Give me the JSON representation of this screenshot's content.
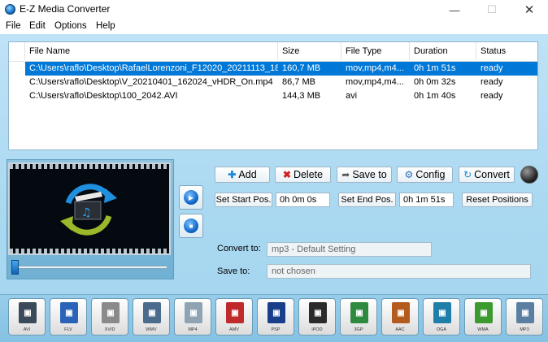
{
  "window": {
    "title": "E-Z Media Converter",
    "minimize": "—",
    "maximize": "☐",
    "close": "✕"
  },
  "menu": [
    "File",
    "Edit",
    "Options",
    "Help"
  ],
  "table": {
    "columns": [
      "File Name",
      "Size",
      "File Type",
      "Duration",
      "Status"
    ],
    "rows": [
      [
        "C:\\Users\\raflo\\Desktop\\RafaelLorenzoni_F12020_20211113_18...",
        "160,7 MB",
        "mov,mp4,m4...",
        "0h 1m 51s",
        "ready"
      ],
      [
        "C:\\Users\\raflo\\Desktop\\V_20210401_162024_vHDR_On.mp4",
        "86,7 MB",
        "mov,mp4,m4...",
        "0h 0m 32s",
        "ready"
      ],
      [
        "C:\\Users\\raflo\\Desktop\\100_2042.AVI",
        "144,3 MB",
        "avi",
        "0h 1m 40s",
        "ready"
      ]
    ],
    "selected_row": 0
  },
  "toolbar": {
    "add": "Add",
    "delete": "Delete",
    "save_to": "Save to",
    "config": "Config",
    "convert": "Convert"
  },
  "positions": {
    "set_start": "Set Start Pos.",
    "start_value": "0h 0m 0s",
    "set_end": "Set End Pos.",
    "end_value": "0h 1m 51s",
    "reset": "Reset Positions"
  },
  "output": {
    "convert_to_label": "Convert to:",
    "convert_to_value": "mp3 - Default Setting",
    "save_to_label": "Save to:",
    "save_to_value": "not chosen"
  },
  "formats": [
    {
      "name": "AVI",
      "color": "#3a4a5a"
    },
    {
      "name": "FLV",
      "color": "#2a63b8"
    },
    {
      "name": "XVID",
      "color": "#8a8a8a"
    },
    {
      "name": "WMV",
      "color": "#4a6b8c"
    },
    {
      "name": "MP4",
      "color": "#8fa3b3"
    },
    {
      "name": "AMV",
      "color": "#c02a2a"
    },
    {
      "name": "PSP",
      "color": "#1a3f8a"
    },
    {
      "name": "iPOD",
      "color": "#2b2b2b"
    },
    {
      "name": "3GP",
      "color": "#2e8a3e"
    },
    {
      "name": "AAC",
      "color": "#b35a1e"
    },
    {
      "name": "OGA",
      "color": "#1f7fa8"
    },
    {
      "name": "WMA",
      "color": "#3d9a2f"
    },
    {
      "name": "MP3",
      "color": "#5b7fa3"
    }
  ]
}
